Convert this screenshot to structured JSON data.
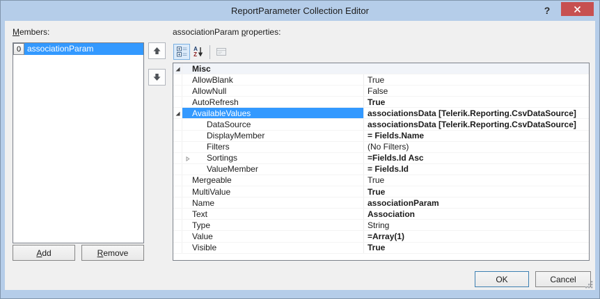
{
  "window": {
    "title": "ReportParameter Collection Editor",
    "help_glyph": "?",
    "close_glyph": "✕"
  },
  "members_panel": {
    "label": {
      "pre": "",
      "key": "M",
      "post": "embers:"
    },
    "items": [
      {
        "index": "0",
        "name": "associationParam",
        "selected": true
      }
    ],
    "buttons": {
      "add": {
        "pre": "",
        "key": "A",
        "post": "dd"
      },
      "remove": {
        "pre": "",
        "key": "R",
        "post": "emove"
      }
    }
  },
  "properties_panel": {
    "label": {
      "pre": "associationParam ",
      "key": "p",
      "post": "roperties:"
    },
    "toolbar": [
      {
        "name": "categorized",
        "selected": true,
        "disabled": false
      },
      {
        "name": "alphabetical",
        "selected": false,
        "disabled": false
      },
      {
        "name": "property-pages",
        "selected": false,
        "disabled": true
      }
    ],
    "grid": {
      "rows": [
        {
          "type": "category",
          "name": "Misc",
          "expander": "expanded"
        },
        {
          "type": "property",
          "level": 0,
          "name": "AllowBlank",
          "value": "True",
          "bold": false
        },
        {
          "type": "property",
          "level": 0,
          "name": "AllowNull",
          "value": "False",
          "bold": false
        },
        {
          "type": "property",
          "level": 0,
          "name": "AutoRefresh",
          "value": "True",
          "bold": true
        },
        {
          "type": "property",
          "level": 0,
          "name": "AvailableValues",
          "value": "associationsData [Telerik.Reporting.CsvDataSource]",
          "bold": true,
          "selected": true,
          "expander": "expanded"
        },
        {
          "type": "property",
          "level": 1,
          "name": "DataSource",
          "value": "associationsData [Telerik.Reporting.CsvDataSource]",
          "bold": true
        },
        {
          "type": "property",
          "level": 1,
          "name": "DisplayMember",
          "value": "= Fields.Name",
          "bold": true
        },
        {
          "type": "property",
          "level": 1,
          "name": "Filters",
          "value": "(No Filters)",
          "bold": false
        },
        {
          "type": "property",
          "level": 1,
          "name": "Sortings",
          "value": "=Fields.Id Asc",
          "bold": true,
          "expander": "collapsed"
        },
        {
          "type": "property",
          "level": 1,
          "name": "ValueMember",
          "value": "= Fields.Id",
          "bold": true
        },
        {
          "type": "property",
          "level": 0,
          "name": "Mergeable",
          "value": "True",
          "bold": false
        },
        {
          "type": "property",
          "level": 0,
          "name": "MultiValue",
          "value": "True",
          "bold": true
        },
        {
          "type": "property",
          "level": 0,
          "name": "Name",
          "value": "associationParam",
          "bold": true
        },
        {
          "type": "property",
          "level": 0,
          "name": "Text",
          "value": "Association",
          "bold": true
        },
        {
          "type": "property",
          "level": 0,
          "name": "Type",
          "value": "String",
          "bold": false
        },
        {
          "type": "property",
          "level": 0,
          "name": "Value",
          "value": "=Array(1)",
          "bold": true
        },
        {
          "type": "property",
          "level": 0,
          "name": "Visible",
          "value": "True",
          "bold": true
        }
      ]
    }
  },
  "footer": {
    "ok": "OK",
    "cancel": "Cancel"
  },
  "colors": {
    "titlebar_blue": "#b5cde9",
    "close_red": "#c75050",
    "selection_blue": "#3399ff",
    "content_bg": "#f0f0f0"
  }
}
